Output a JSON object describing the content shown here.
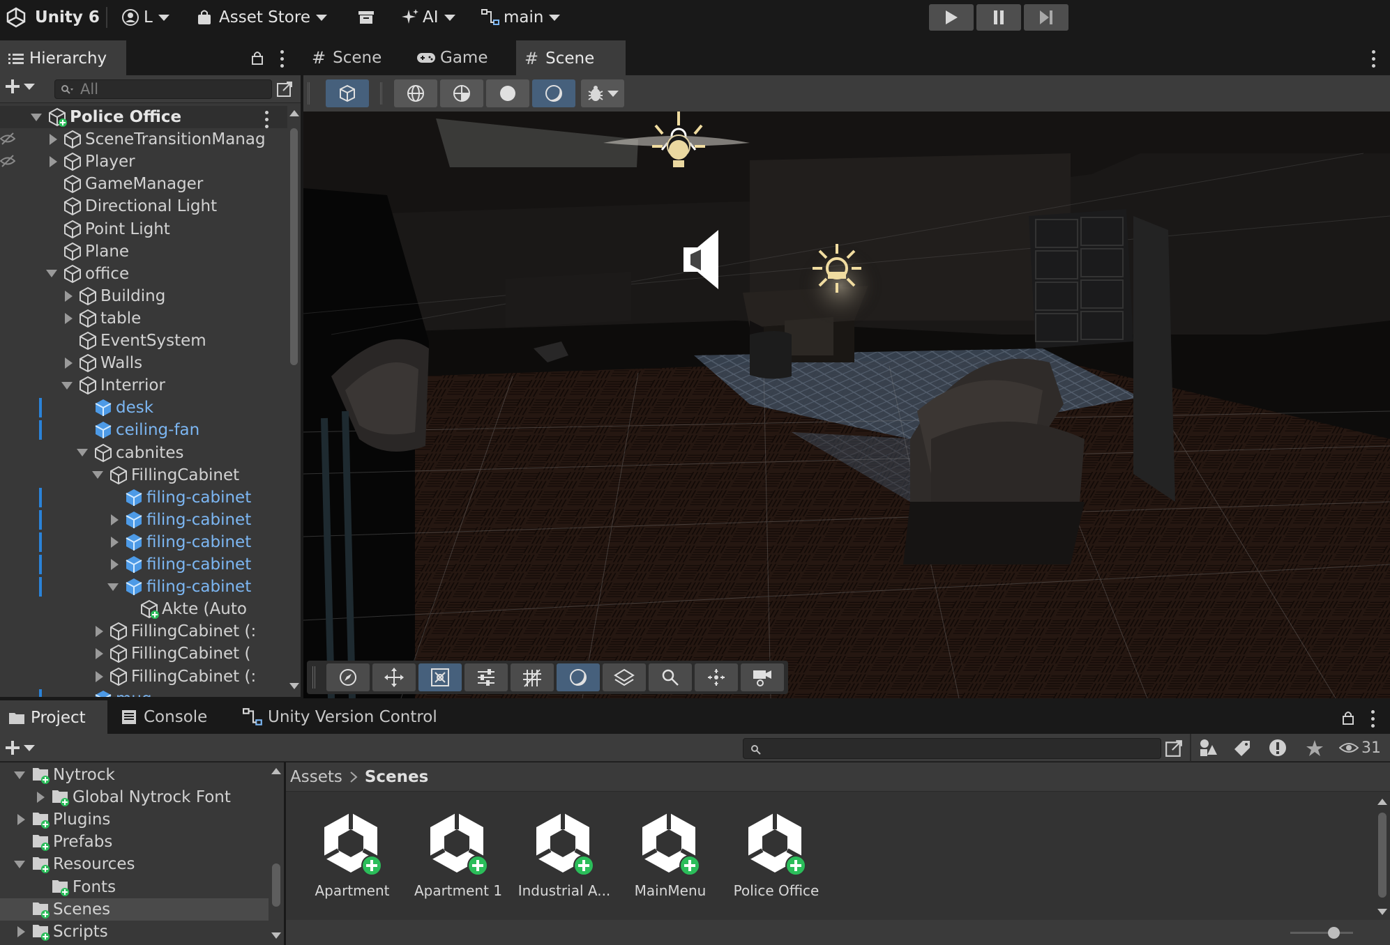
{
  "toolbar": {
    "app_name": "Unity 6",
    "account": "L",
    "asset_store": "Asset Store",
    "ai": "AI",
    "branch": "main"
  },
  "hierarchy": {
    "tab": "Hierarchy",
    "search_placeholder": "All",
    "rows": [
      {
        "label": "Police Office",
        "indent": 0,
        "arrow": "down",
        "kind": "scene"
      },
      {
        "label": "SceneTransitionManag",
        "indent": 1,
        "arrow": "right",
        "kind": "object"
      },
      {
        "label": "Player",
        "indent": 1,
        "arrow": "right",
        "kind": "object"
      },
      {
        "label": "GameManager",
        "indent": 1,
        "arrow": "",
        "kind": "object"
      },
      {
        "label": "Directional Light",
        "indent": 1,
        "arrow": "",
        "kind": "object"
      },
      {
        "label": "Point Light",
        "indent": 1,
        "arrow": "",
        "kind": "object"
      },
      {
        "label": "Plane",
        "indent": 1,
        "arrow": "",
        "kind": "object"
      },
      {
        "label": "office",
        "indent": 1,
        "arrow": "down",
        "kind": "object"
      },
      {
        "label": "Building",
        "indent": 2,
        "arrow": "right",
        "kind": "object"
      },
      {
        "label": "table",
        "indent": 2,
        "arrow": "right",
        "kind": "object"
      },
      {
        "label": "EventSystem",
        "indent": 2,
        "arrow": "",
        "kind": "object"
      },
      {
        "label": "Walls",
        "indent": 2,
        "arrow": "right",
        "kind": "object"
      },
      {
        "label": "Interrior",
        "indent": 2,
        "arrow": "down",
        "kind": "object"
      },
      {
        "label": "desk",
        "indent": 3,
        "arrow": "",
        "kind": "prefab"
      },
      {
        "label": "ceiling-fan",
        "indent": 3,
        "arrow": "",
        "kind": "prefab"
      },
      {
        "label": "cabnites",
        "indent": 3,
        "arrow": "down",
        "kind": "object"
      },
      {
        "label": "FillingCabinet",
        "indent": 4,
        "arrow": "down",
        "kind": "object"
      },
      {
        "label": "filing-cabinet",
        "indent": 5,
        "arrow": "",
        "kind": "prefab"
      },
      {
        "label": "filing-cabinet",
        "indent": 5,
        "arrow": "right",
        "kind": "prefab"
      },
      {
        "label": "filing-cabinet",
        "indent": 5,
        "arrow": "right",
        "kind": "prefab"
      },
      {
        "label": "filing-cabinet",
        "indent": 5,
        "arrow": "right",
        "kind": "prefab"
      },
      {
        "label": "filing-cabinet",
        "indent": 5,
        "arrow": "down",
        "kind": "prefab"
      },
      {
        "label": "Akte (Auto",
        "indent": 6,
        "arrow": "",
        "kind": "added"
      },
      {
        "label": "FillingCabinet (:",
        "indent": 4,
        "arrow": "right",
        "kind": "object"
      },
      {
        "label": "FillingCabinet (",
        "indent": 4,
        "arrow": "right",
        "kind": "object"
      },
      {
        "label": "FillingCabinet (:",
        "indent": 4,
        "arrow": "right",
        "kind": "object"
      },
      {
        "label": "mug",
        "indent": 3,
        "arrow": "",
        "kind": "prefab"
      }
    ]
  },
  "scene_tabs": [
    "Scene",
    "Game",
    "Scene"
  ],
  "project": {
    "tabs": [
      "Project",
      "Console",
      "Unity Version Control"
    ],
    "visible_count": "31",
    "tree": [
      {
        "label": "Nytrock",
        "indent": 1,
        "arrow": "down"
      },
      {
        "label": "Global Nytrock Font",
        "indent": 2,
        "arrow": "right"
      },
      {
        "label": "Plugins",
        "indent": 1,
        "arrow": "right"
      },
      {
        "label": "Prefabs",
        "indent": 1,
        "arrow": ""
      },
      {
        "label": "Resources",
        "indent": 1,
        "arrow": "down"
      },
      {
        "label": "Fonts",
        "indent": 2,
        "arrow": ""
      },
      {
        "label": "Scenes",
        "indent": 1,
        "arrow": "",
        "selected": true
      },
      {
        "label": "Scripts",
        "indent": 1,
        "arrow": "right"
      }
    ],
    "breadcrumb": [
      "Assets",
      "Scenes"
    ],
    "assets": [
      "Apartment",
      "Apartment 1",
      "Industrial A...",
      "MainMenu",
      "Police Office"
    ]
  }
}
